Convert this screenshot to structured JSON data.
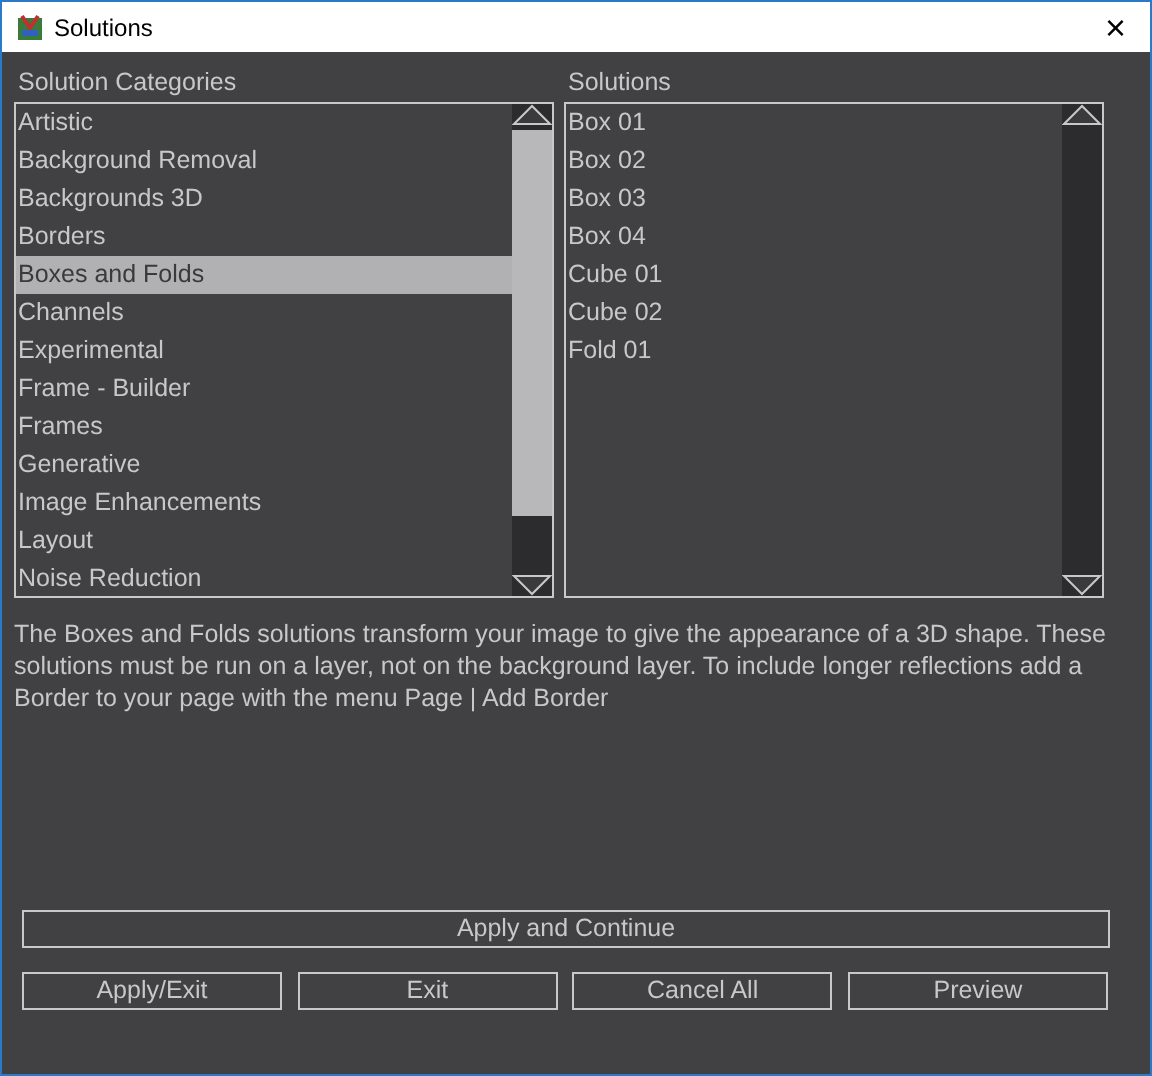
{
  "window": {
    "title": "Solutions",
    "close": "×"
  },
  "categories": {
    "label": "Solution Categories",
    "items": [
      {
        "label": "Artistic",
        "selected": false
      },
      {
        "label": "Background Removal",
        "selected": false
      },
      {
        "label": "Backgrounds 3D",
        "selected": false
      },
      {
        "label": "Borders",
        "selected": false
      },
      {
        "label": "Boxes and Folds",
        "selected": true
      },
      {
        "label": "Channels",
        "selected": false
      },
      {
        "label": "Experimental",
        "selected": false
      },
      {
        "label": "Frame - Builder",
        "selected": false
      },
      {
        "label": "Frames",
        "selected": false
      },
      {
        "label": "Generative",
        "selected": false
      },
      {
        "label": "Image Enhancements",
        "selected": false
      },
      {
        "label": "Layout",
        "selected": false
      },
      {
        "label": "Noise Reduction",
        "selected": false
      }
    ]
  },
  "solutions": {
    "label": "Solutions",
    "items": [
      {
        "label": "Box 01",
        "selected": false
      },
      {
        "label": "Box 02",
        "selected": false
      },
      {
        "label": "Box 03",
        "selected": false
      },
      {
        "label": "Box 04",
        "selected": false
      },
      {
        "label": "Cube 01",
        "selected": false
      },
      {
        "label": "Cube 02",
        "selected": false
      },
      {
        "label": "Fold 01",
        "selected": false
      }
    ]
  },
  "description": "The Boxes and Folds solutions transform your image to give the appearance of a 3D shape. These solutions must be run on a layer, not on the background layer. To include longer reflections add a Border to your page with the menu Page | Add Border",
  "main_button": "Apply and Continue",
  "buttons": [
    "Apply/Exit",
    "Exit",
    "Cancel All",
    "Preview"
  ]
}
